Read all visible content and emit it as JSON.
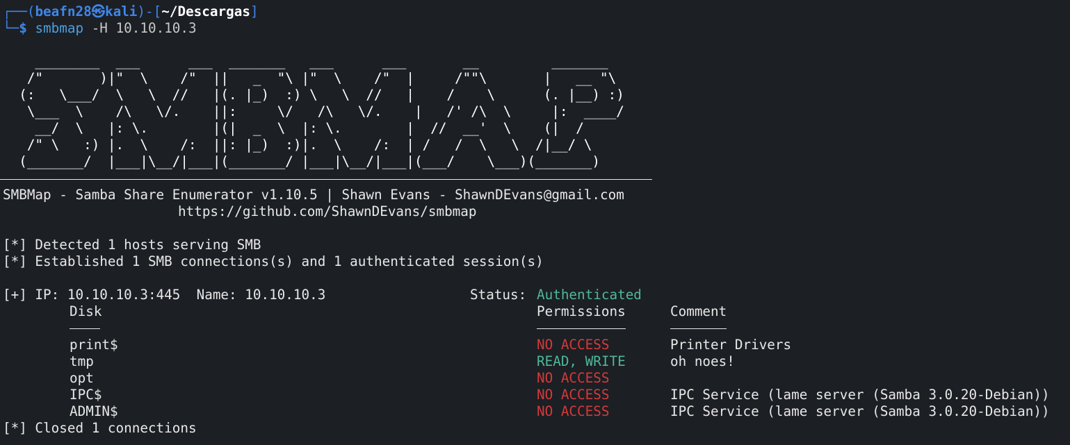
{
  "prompt": {
    "corner_top": "┌──(",
    "user": "beafn28",
    "at_symbol": "㉿",
    "host": "kali",
    "mid": ")-[",
    "path": "~/Descargas",
    "close": "]",
    "corner_bottom": "└─",
    "dollar": "$",
    "command": "smbmap",
    "args": "-H 10.10.10.3"
  },
  "banner": [
    "    ________  ___      ___  _______   ___      ___       __         _______",
    "   /\"       )|\"  \\    /\"  ||   _  \"\\ |\"  \\    /\"  |     /\"\"\\       |   __ \"\\",
    "  (:   \\___/  \\   \\  //   |(. |_)  :) \\   \\  //   |    /    \\      (. |__) :)",
    "   \\___  \\    /\\   \\/.    ||:     \\/   /\\   \\/.    |   /' /\\  \\     |:  ____/",
    "    __/  \\   |: \\.        |(|  _  \\  |: \\.        |  //  __'  \\    (|  /",
    "   /\" \\   :) |.  \\    /:  ||: |_)  :)|.  \\    /:  | /   /  \\   \\  /|__/ \\",
    "  (_______/  |___|\\__/|___|(_______/ |___|\\__/|___|(___/    \\___)(_______)"
  ],
  "credits": {
    "line1": "SMBMap - Samba Share Enumerator v1.10.5 | Shawn Evans - ShawnDEvans@gmail.com",
    "line2": "https://github.com/ShawnDEvans/smbmap"
  },
  "log": {
    "detected": "[*] Detected 1 hosts serving SMB",
    "established": "[*] Established 1 SMB connections(s) and 1 authenticated session(s)",
    "closed": "[*] Closed 1 connections"
  },
  "host_line": {
    "prefix": "[+] IP: 10.10.10.3:445  Name: 10.10.10.3",
    "status_label": "Status:",
    "status_value": "Authenticated"
  },
  "table": {
    "headers": {
      "disk": "Disk",
      "permissions": "Permissions",
      "comment": "Comment"
    },
    "underlines": {
      "disk": "----",
      "permissions": "-----------",
      "comment": "-------"
    },
    "rows": [
      {
        "disk": "print$",
        "permissions": "NO ACCESS",
        "perm_kind": "denied",
        "comment": "Printer Drivers"
      },
      {
        "disk": "tmp",
        "permissions": "READ, WRITE",
        "perm_kind": "granted",
        "comment": "oh noes!"
      },
      {
        "disk": "opt",
        "permissions": "NO ACCESS",
        "perm_kind": "denied",
        "comment": ""
      },
      {
        "disk": "IPC$",
        "permissions": "NO ACCESS",
        "perm_kind": "denied",
        "comment": "IPC Service (lame server (Samba 3.0.20-Debian))"
      },
      {
        "disk": "ADMIN$",
        "permissions": "NO ACCESS",
        "perm_kind": "denied",
        "comment": "IPC Service (lame server (Samba 3.0.20-Debian))"
      }
    ]
  },
  "colors": {
    "background": "#1c1f24",
    "prompt_blue": "#3f86e8",
    "authenticated_green": "#4fb89a",
    "no_access_red": "#d43a3a"
  }
}
